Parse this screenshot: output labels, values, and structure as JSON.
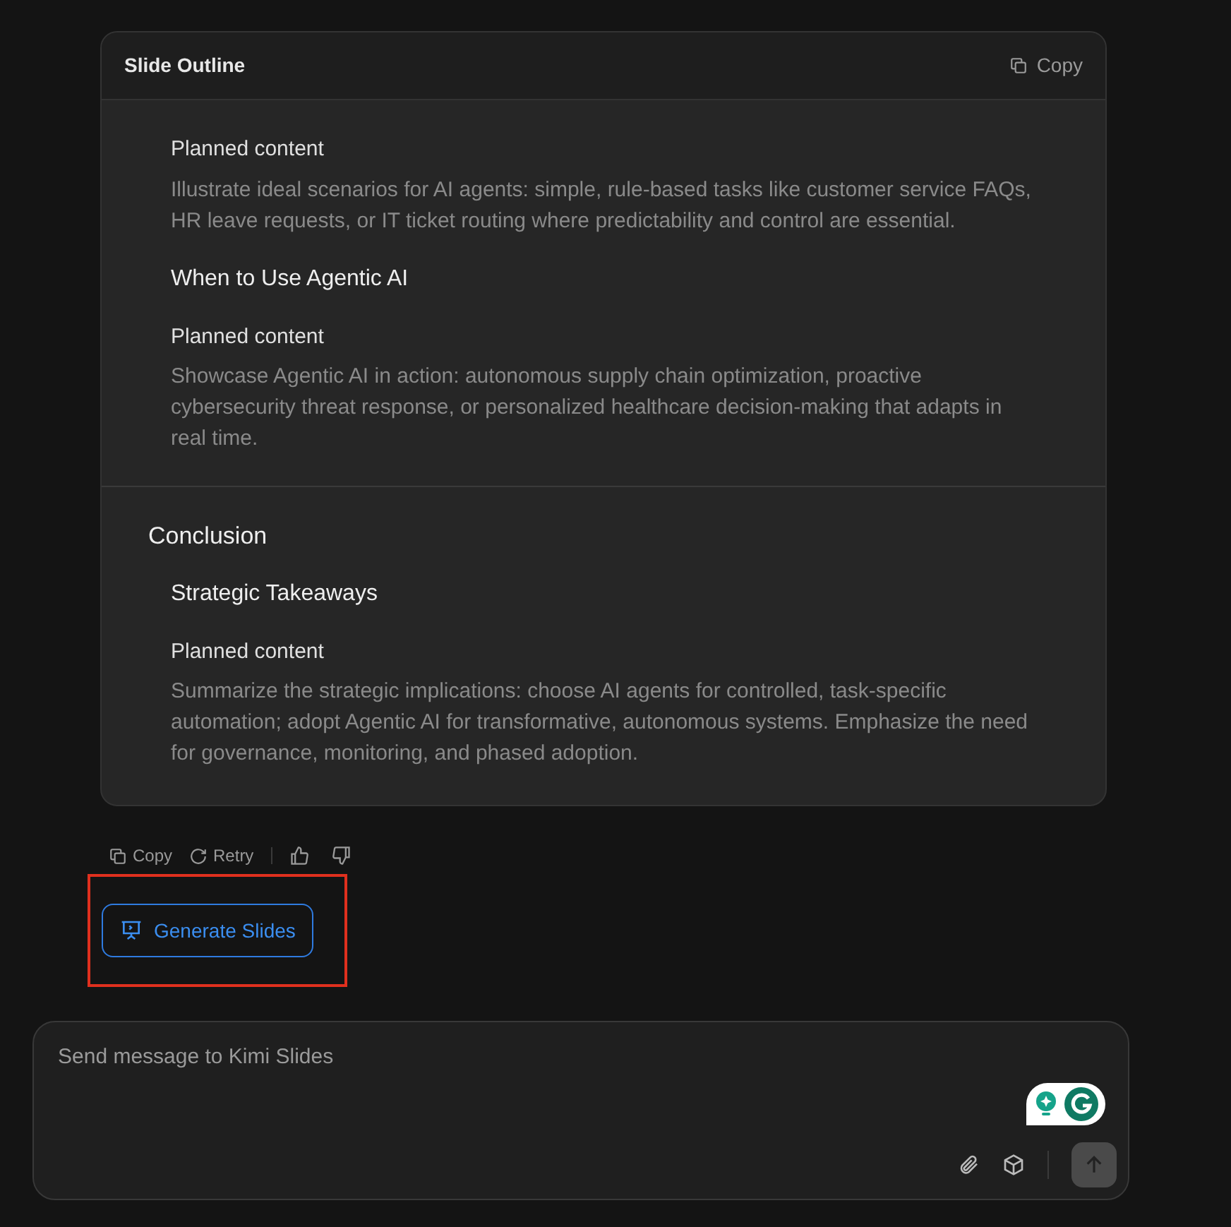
{
  "outline": {
    "title": "Slide Outline",
    "copy_label": "Copy",
    "sections": [
      {
        "slides": [
          {
            "label": "Planned content",
            "content": "Illustrate ideal scenarios for AI agents: simple, rule-based tasks like customer service FAQs, HR leave requests, or IT ticket routing where predictability and control are essential."
          },
          {
            "title": "When to Use Agentic AI",
            "label": "Planned content",
            "content": "Showcase Agentic AI in action: autonomous supply chain optimization, proactive cybersecurity threat response, or personalized healthcare decision-making that adapts in real time."
          }
        ]
      },
      {
        "title": "Conclusion",
        "slides": [
          {
            "title": "Strategic Takeaways",
            "label": "Planned content",
            "content": "Summarize the strategic implications: choose AI agents for controlled, task-specific automation; adopt Agentic AI for transformative, autonomous systems. Emphasize the need for governance, monitoring, and phased adoption."
          }
        ]
      }
    ]
  },
  "actions": {
    "copy": "Copy",
    "retry": "Retry"
  },
  "generate": {
    "label": "Generate Slides",
    "highlighted": true
  },
  "composer": {
    "placeholder": "Send message to Kimi Slides"
  }
}
